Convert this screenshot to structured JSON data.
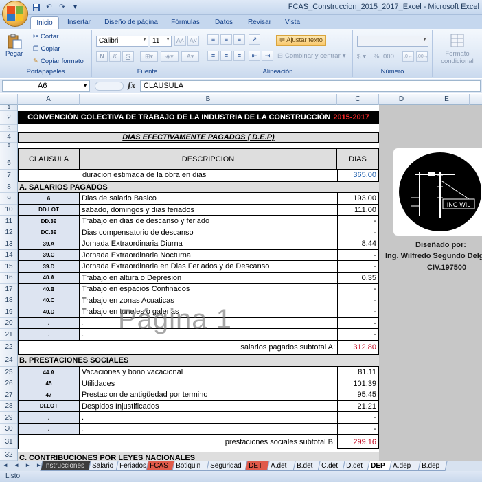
{
  "window": {
    "title": "FCAS_Construccion_2015_2017_Excel - Microsoft Excel"
  },
  "ribbon": {
    "tabs": [
      "Inicio",
      "Insertar",
      "Diseño de página",
      "Fórmulas",
      "Datos",
      "Revisar",
      "Vista"
    ],
    "clipboard": {
      "paste": "Pegar",
      "cut": "Cortar",
      "copy": "Copiar",
      "format_painter": "Copiar formato",
      "label": "Portapapeles"
    },
    "font": {
      "name": "Calibri",
      "size": "11",
      "bold": "N",
      "italic": "K",
      "underline": "S",
      "label": "Fuente"
    },
    "alignment": {
      "wrap": "Ajustar texto",
      "merge": "Combinar y centrar",
      "label": "Alineación"
    },
    "number": {
      "label": "Número",
      "currency": "$",
      "percent": "%",
      "thousands": "000"
    },
    "styles": {
      "conditional": "Formato condicional"
    }
  },
  "formula_bar": {
    "name_box": "A6",
    "fx": "fx",
    "content": "CLAUSULA"
  },
  "columns": [
    "A",
    "B",
    "C",
    "D",
    "E"
  ],
  "rows": [
    "1",
    "2",
    "3",
    "4",
    "5",
    "6",
    "7",
    "8",
    "9",
    "10",
    "11",
    "12",
    "13",
    "14",
    "15",
    "16",
    "17",
    "18",
    "19",
    "20",
    "21",
    "22",
    "24",
    "25",
    "26",
    "27",
    "28",
    "29",
    "30",
    "31",
    "32"
  ],
  "sheet": {
    "banner_title": "CONVENCIÓN COLECTIVA DE TRABAJO DE LA INDUSTRIA DE LA CONSTRUCCIÓN",
    "banner_years": "2015-2017",
    "subtitle": "DIAS EFECTIVAMENTE PAGADOS ( D.E.P)",
    "headers": {
      "clausula": "CLAUSULA",
      "descripcion": "DESCRIPCION",
      "dias": "DIAS"
    },
    "duration": {
      "label": "duracion estimada de la obra en dias",
      "value": "365.00"
    },
    "section_a": "A. SALARIOS PAGADOS",
    "salarios": [
      {
        "code": "6",
        "desc": "Dias de salario Basico",
        "value": "193.00"
      },
      {
        "code": "DD.LOT",
        "desc": "sabado, domingos y dias feriados",
        "value": "111.00"
      },
      {
        "code": "DD.39",
        "desc": "Trabajo en dias de descanso y feriado",
        "value": "-"
      },
      {
        "code": "DC.39",
        "desc": "Dias compensatorio de descanso",
        "value": "-"
      },
      {
        "code": "39.A",
        "desc": "Jornada Extraordinaria Diurna",
        "value": "8.44"
      },
      {
        "code": "39.C",
        "desc": "Jornada Extraordinaria Nocturna",
        "value": "-"
      },
      {
        "code": "39.D",
        "desc": "Jornada Extraordinaria en Dias Feriados y de Descanso",
        "value": "-"
      },
      {
        "code": "40.A",
        "desc": "Trabajo en altura o Depresion",
        "value": "0.35"
      },
      {
        "code": "40.B",
        "desc": "Trabajo en espacios Confinados",
        "value": "-"
      },
      {
        "code": "40.C",
        "desc": "Trabajo en zonas Acuaticas",
        "value": "-"
      },
      {
        "code": "40.D",
        "desc": "Trabajo en tuneles o galerias",
        "value": "-"
      },
      {
        "code": ".",
        "desc": ".",
        "value": "-"
      },
      {
        "code": ".",
        "desc": ".",
        "value": "-"
      }
    ],
    "subtotal_a": {
      "label": "salarios pagados subtotal A:",
      "value": "312.80"
    },
    "section_b": "B. PRESTACIONES SOCIALES",
    "prestaciones": [
      {
        "code": "44.A",
        "desc": "Vacaciones y bono vacacional",
        "value": "81.11"
      },
      {
        "code": "45",
        "desc": "Utilidades",
        "value": "101.39"
      },
      {
        "code": "47",
        "desc": "Prestacion de antigüedad por termino",
        "value": "95.45"
      },
      {
        "code": "DI.LOT",
        "desc": "Despidos Injustificados",
        "value": "21.21"
      },
      {
        "code": ".",
        "desc": ".",
        "value": "-"
      },
      {
        "code": ".",
        "desc": ".",
        "value": "-"
      }
    ],
    "subtotal_b": {
      "label": "prestaciones sociales subtotal B:",
      "value": "299.16"
    },
    "section_c": "C. CONTRIBUCIONES POR LEYES NACIONALES",
    "logo_text": "ING WIL",
    "credit": {
      "designed_by": "Diseñado por:",
      "author": "Ing. Wilfredo Segundo Delg",
      "civ": "CIV.197500"
    },
    "watermark": "Página 1"
  },
  "sheet_tabs": [
    "Instrucciones",
    "Salario",
    "Feriados",
    "FCAS",
    "Botiquin",
    "Seguridad",
    "DET",
    "A.det",
    "B.det",
    "C.det",
    "D.det",
    "DEP",
    "A.dep",
    "B.dep"
  ],
  "active_tab": "DEP",
  "status": "Listo",
  "colors": {
    "accent_red": "#ff2a2a",
    "link_blue": "#1f5fad",
    "header_fill": "#dedede",
    "code_fill": "#dde4f1",
    "fcas_tab": "#e05a4a",
    "det_tab": "#e05a4a",
    "instr_tab": "#3c3c3c"
  }
}
